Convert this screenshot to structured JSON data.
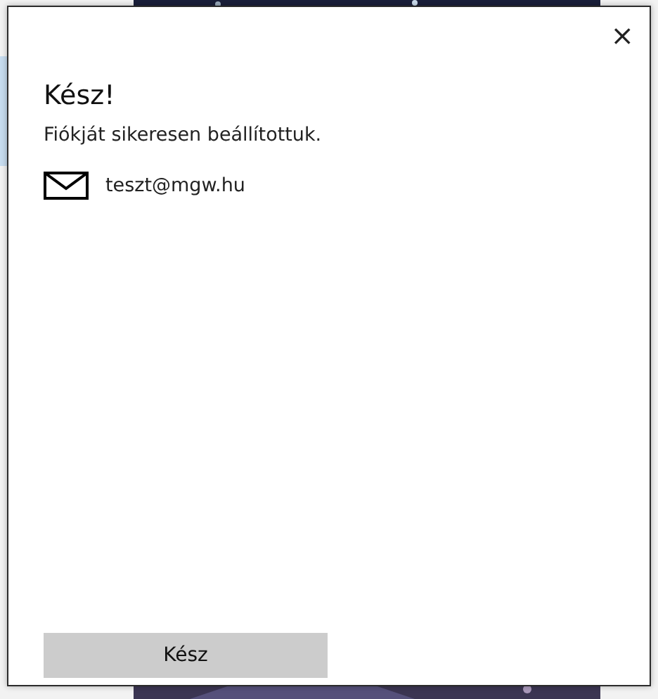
{
  "dialog": {
    "close": "×",
    "title": "Kész!",
    "message": "Fiókját sikeresen beállítottuk.",
    "account": "teszt@mgw.hu",
    "button": "Kész"
  }
}
